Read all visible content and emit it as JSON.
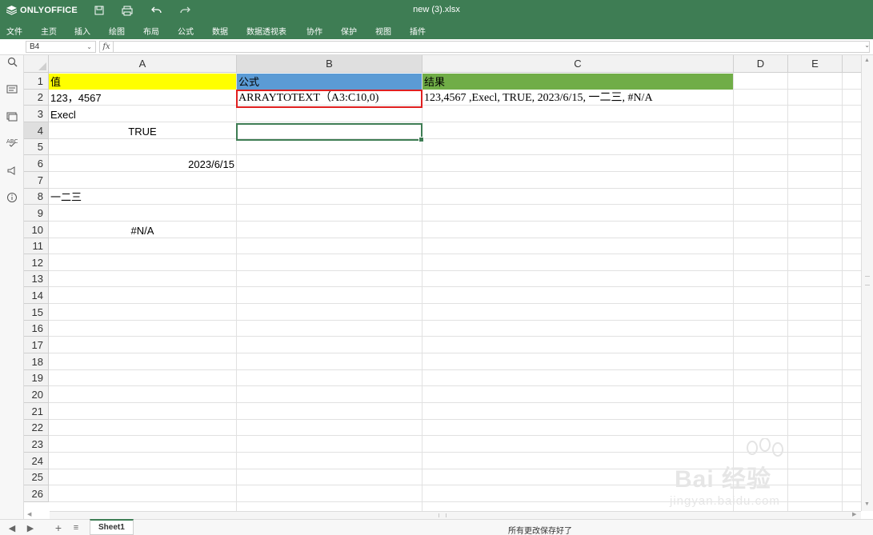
{
  "app": {
    "logo_text": "ONLYOFFICE",
    "doc_title": "new (3).xlsx"
  },
  "menu": [
    "文件",
    "主页",
    "插入",
    "绘图",
    "布局",
    "公式",
    "数据",
    "数据透视表",
    "协作",
    "保护",
    "视图",
    "插件"
  ],
  "formula_bar": {
    "name_box": "B4",
    "fx_label": "fx",
    "formula": ""
  },
  "columns": [
    "A",
    "B",
    "C",
    "D",
    "E"
  ],
  "rows": [
    "1",
    "2",
    "3",
    "4",
    "5",
    "6",
    "7",
    "8",
    "9",
    "10",
    "11",
    "12",
    "13",
    "14",
    "15",
    "16",
    "17",
    "18",
    "19",
    "20",
    "21",
    "22",
    "23",
    "24",
    "25",
    "26"
  ],
  "cells": {
    "A1": "值",
    "B1": "公式",
    "C1": "结果",
    "A2": "123，4567",
    "B2": "ARRAYTOTEXT（A3:C10,0)",
    "C2": "123,4567 ,Execl, TRUE, 2023/6/15, 一二三, #N/A",
    "A3": "Execl",
    "A4": "TRUE",
    "A6": "2023/6/15",
    "A8": "一二三",
    "A10": "#N/A"
  },
  "header_fills": {
    "A1": "#ffff00",
    "B1": "#5b9bd5",
    "C1": "#70ad47"
  },
  "selected_cell": "B4",
  "status": {
    "sheet_tab": "Sheet1",
    "save_message": "所有更改保存好了"
  },
  "watermark": {
    "brand": "Bai 经验",
    "url": "jingyan.baidu.com"
  },
  "icons": {
    "title_bar": [
      "save-icon",
      "print-icon",
      "undo-icon",
      "redo-icon"
    ],
    "sidebar": [
      "search-icon",
      "comment-icon",
      "chat-icon",
      "spellcheck-icon",
      "feedback-icon",
      "info-icon"
    ]
  }
}
